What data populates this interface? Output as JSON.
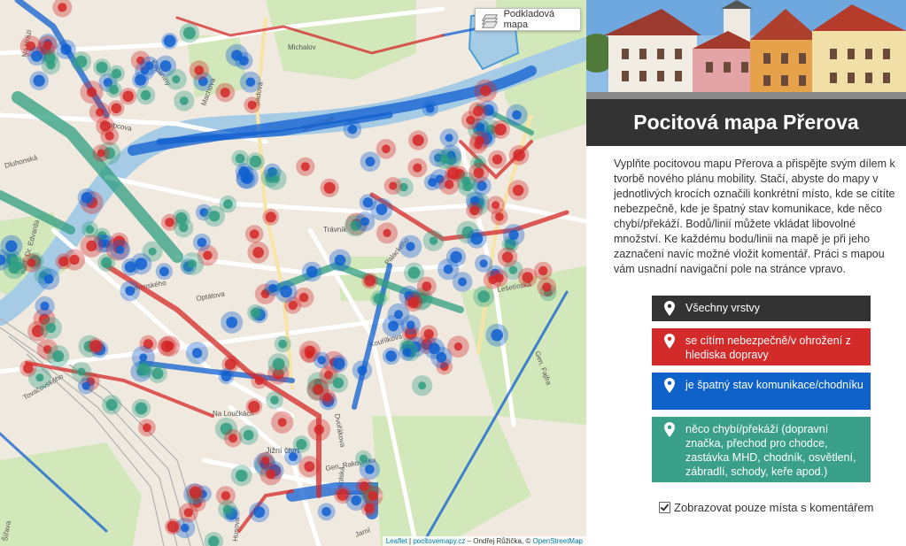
{
  "map": {
    "layer_button_label": "Podkladová mapa",
    "attribution": {
      "leaflet": "Leaflet",
      "site": "pocitovemapy.cz",
      "author": " – Ondřej Růžička, © ",
      "osm": "OpenStreetMap"
    },
    "street_labels": [
      "Na Hrázi",
      "Michalov",
      "Kopaniny",
      "Machova",
      "Sadová",
      "Bezručova",
      "Brabcova",
      "Dluhonská",
      "nábř. Dr. Edvarda",
      "Palackého",
      "Komenského",
      "Na Loučkách",
      "Jižní čtvrť",
      "Gen. Rakovníka",
      "Jarní",
      "Sokolská",
      "Kouřílkova",
      "Tovačovského",
      "Šířava",
      "Gen. Fajfra",
      "Dvořákova",
      "Lešetínská",
      "Optátova",
      "Husova",
      "Trávník"
    ],
    "colors": {
      "red": "#d42727",
      "blue": "#0f5fd0",
      "green": "#2f9e80"
    }
  },
  "panel": {
    "title": "Pocitová mapa Přerova",
    "intro": "Vyplňte pocitovou mapu Přerova a přispějte svým dílem k tvorbě nového plánu mobility. Stačí, abyste do mapy v jednotlivých krocích označili konkrétní místo, kde se cítíte nebezpečně, kde je špatný stav komunikace, kde něco chybí/překáží. Bodů/linií můžete vkládat libovolné množství. Ke každému bodu/linii na mapě je při jeho zaznačení navíc možné vložit komentář. Práci s mapou vám usnadní navigační pole na stránce vpravo.",
    "layers": {
      "all": "Všechny vrstvy",
      "danger": "se cítím nebezpečně/v ohrožení z hlediska dopravy",
      "bad_road": "je špatný stav komunikace/chodníku",
      "missing": "něco chybí/překáží (dopravní značka, přechod pro chodce, zastávka MHD, chodník, osvětlení, zábradlí, schody, keře apod.)"
    },
    "only_comments_label": "Zobrazovat pouze místa s komentářem",
    "only_comments_checked": true,
    "colors": {
      "dark": "#333333",
      "red": "#d32a2a",
      "blue": "#0e62c9",
      "green": "#3aa089"
    }
  }
}
